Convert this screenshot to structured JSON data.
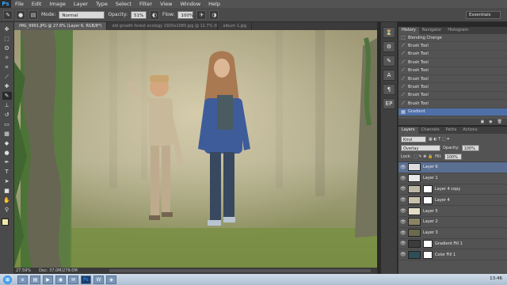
{
  "app": {
    "logo": "Ps"
  },
  "menu": [
    "File",
    "Edit",
    "Image",
    "Layer",
    "Type",
    "Select",
    "Filter",
    "View",
    "Window",
    "Help"
  ],
  "options": {
    "mode_label": "Mode:",
    "mode_value": "Normal",
    "opacity_label": "Opacity:",
    "opacity_value": "51%",
    "flow_label": "Flow:",
    "flow_value": "100%",
    "workspace": "Essentials"
  },
  "tabs": [
    "IMG_9991.JPG @ 27.6% (Layer 6, RGB/8*)",
    "old growth forest ecology 1920x1080.jpg @ 11.7% (RGB/8*)",
    "album 1.jpg"
  ],
  "tools": [
    "move",
    "marquee",
    "lasso",
    "quick-select",
    "crop",
    "eyedropper",
    "healing",
    "brush",
    "stamp",
    "history-brush",
    "eraser",
    "gradient",
    "blur",
    "dodge",
    "pen",
    "type",
    "path-select",
    "shape",
    "hand",
    "zoom"
  ],
  "colors": {
    "foreground": "#f1e7a6",
    "background": "#ffffff"
  },
  "status": {
    "zoom": "27.59%",
    "doc": "Doc: 37.0M/279.0M"
  },
  "history": {
    "tabs": [
      "History",
      "Navigator",
      "Histogram"
    ],
    "items": [
      "Blending Change",
      "Brush Tool",
      "Brush Tool",
      "Brush Tool",
      "Brush Tool",
      "Brush Tool",
      "Brush Tool",
      "Brush Tool",
      "Brush Tool",
      "Gradient"
    ]
  },
  "layers": {
    "tabs": [
      "Layers",
      "Channels",
      "Paths",
      "Actions"
    ],
    "kind": "Kind",
    "blend": "Overlay",
    "opacity_label": "Opacity:",
    "opacity": "100%",
    "lock_label": "Lock:",
    "fill_label": "Fill:",
    "fill": "100%",
    "items": [
      {
        "name": "Layer 6",
        "thumb": "#dcdcdc"
      },
      {
        "name": "Layer 1",
        "thumb": "#e8e8e8"
      },
      {
        "name": "Layer 4 copy",
        "thumb": "#bdb8a5"
      },
      {
        "name": "Layer 4",
        "thumb": "#c8c2ad"
      },
      {
        "name": "Layer 5",
        "thumb": "#e4dcc6"
      },
      {
        "name": "Layer 2",
        "thumb": "#8a8464"
      },
      {
        "name": "Layer 3",
        "thumb": "#6b6a4f"
      },
      {
        "name": "Gradient Fill 1",
        "thumb": "#3c3c3c"
      },
      {
        "name": "Color Fill 1",
        "thumb": "#2f4d57"
      }
    ]
  },
  "taskbar": {
    "clock": "13:46"
  }
}
